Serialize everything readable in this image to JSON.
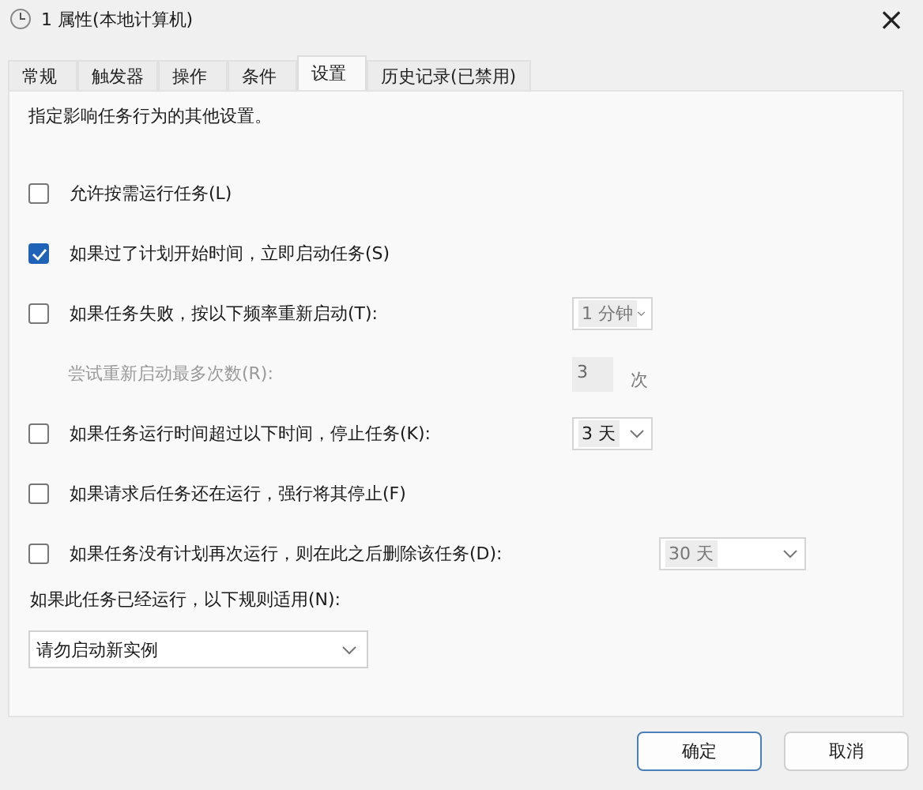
{
  "window": {
    "title": "1 属性(本地计算机)",
    "close": "×"
  },
  "tabs": [
    {
      "label": "常规",
      "selected": false
    },
    {
      "label": "触发器",
      "selected": false
    },
    {
      "label": "操作",
      "selected": false
    },
    {
      "label": "条件",
      "selected": false
    },
    {
      "label": "设置",
      "selected": true
    },
    {
      "label": "历史记录(已禁用)",
      "selected": false
    }
  ],
  "description": "指定影响任务行为的其他设置。",
  "options": [
    {
      "kind": "checkbox",
      "label": "允许按需运行任务(L)",
      "checked": false
    },
    {
      "kind": "checkbox",
      "label": "如果过了计划开始时间，立即启动任务(S)",
      "checked": true
    },
    {
      "kind": "checkbox",
      "label": "如果任务失败，按以下频率重新启动(T):",
      "checked": false,
      "dropdown": {
        "value": "1 分钟",
        "disabled": true
      }
    },
    {
      "kind": "subfield",
      "label": "尝试重新启动最多次数(R):",
      "disabled": true,
      "field": {
        "value": "3",
        "disabled": true
      },
      "unit": "次"
    },
    {
      "kind": "checkbox",
      "label": "如果任务运行时间超过以下时间，停止任务(K):",
      "checked": false,
      "dropdown": {
        "value": "3 天",
        "disabled": false
      }
    },
    {
      "kind": "checkbox",
      "label": "如果请求后任务还在运行，强行将其停止(F)",
      "checked": false
    },
    {
      "kind": "checkbox",
      "label": "如果任务没有计划再次运行，则在此之后删除该任务(D):",
      "checked": false,
      "wide": true,
      "dropdown": {
        "value": "30 天",
        "disabled": true
      }
    }
  ],
  "rule": {
    "label": "如果此任务已经运行，以下规则适用(N):",
    "value": "请勿启动新实例"
  },
  "buttons": [
    {
      "label": "确定",
      "default": true
    },
    {
      "label": "取消",
      "default": false
    }
  ]
}
